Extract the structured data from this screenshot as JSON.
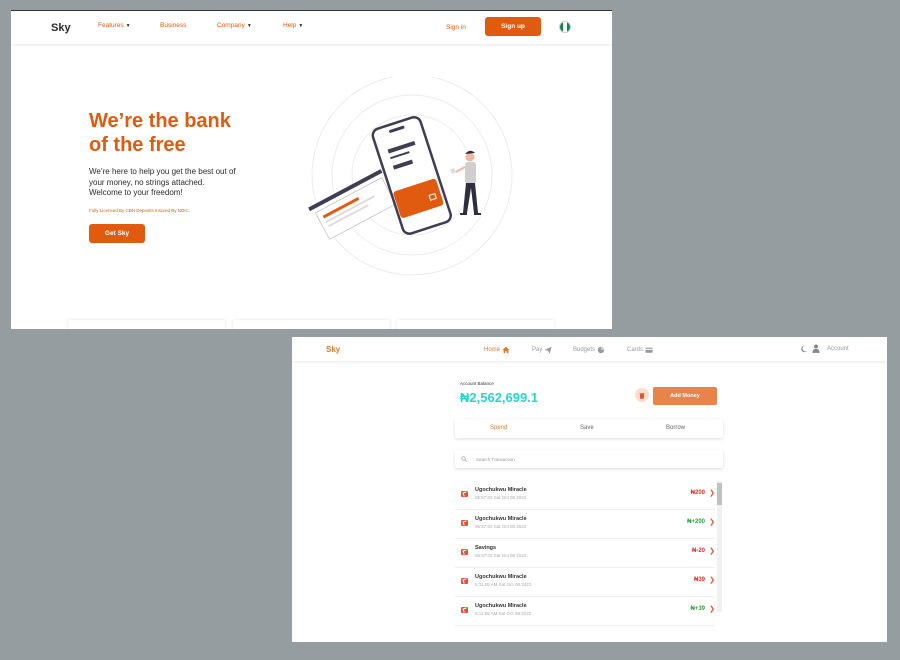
{
  "landing": {
    "nav": {
      "logo": "Sky",
      "links": [
        {
          "label": "Features",
          "caret": "▼"
        },
        {
          "label": "Business",
          "caret": ""
        },
        {
          "label": "Company",
          "caret": "▼"
        },
        {
          "label": "Help",
          "caret": "▼"
        }
      ],
      "sign_in": "Sign in",
      "sign_up": "Sign up",
      "flag_colors": [
        "#008751",
        "#ffffff",
        "#008751"
      ]
    },
    "hero": {
      "headline_line1": "We’re the bank",
      "headline_line2": "of the free",
      "sub_line1": "We’re here to help you get the best out of",
      "sub_line2": "your money, no strings attached.",
      "sub_line3": "Welcome to your freedom!",
      "licensed": "Fully Licensed By CBN Deposits Insured By NDIC",
      "cta": "Get Sky"
    },
    "accent_color": "#e05a10"
  },
  "dashboard": {
    "nav": {
      "logo": "Sky",
      "tabs": [
        {
          "label": "Home",
          "icon": "home-icon"
        },
        {
          "label": "Pay",
          "icon": "paper-plane-icon"
        },
        {
          "label": "Budgets",
          "icon": "pie-chart-icon"
        },
        {
          "label": "Cards",
          "icon": "credit-card-icon"
        }
      ],
      "account": "Account"
    },
    "balance_label": "Account Balance",
    "balance_value": "₦2,562,699.1",
    "add_money": "Add Money",
    "segments": [
      "Spend",
      "Save",
      "Borrow"
    ],
    "search_placeholder": "Search Transaction",
    "transactions": [
      {
        "name": "Ugochukwu Miracle",
        "date": "05:57:02 Sat Oct 08 2022",
        "amount": "₦200",
        "color": "#e0302a"
      },
      {
        "name": "Ugochukwu Miracle",
        "date": "05:57:02 Sat Oct 08 2022",
        "amount": "₦+200",
        "color": "#2e9e3a"
      },
      {
        "name": "Savings",
        "date": "05:57:02 Sat Oct 08 2022",
        "amount": "₦-20",
        "color": "#e0302a"
      },
      {
        "name": "Ugochukwu Miracle",
        "date": "5:11:55 AM Sat Oct 08 2022",
        "amount": "₦39",
        "color": "#e0302a"
      },
      {
        "name": "Ugochukwu Miracle",
        "date": "5:11:55 AM Sat Oct 08 2022",
        "amount": "₦+39",
        "color": "#2e9e3a"
      }
    ],
    "balance_color": "#27d5d0",
    "accent_color": "#e07a2e"
  }
}
